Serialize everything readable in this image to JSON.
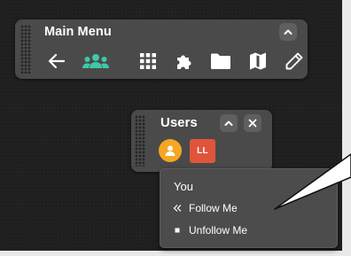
{
  "main_menu": {
    "title": "Main Menu",
    "collapse_icon": "chevron-up-icon",
    "tools": [
      {
        "name": "back",
        "icon": "arrow-left-icon",
        "active": false
      },
      {
        "name": "users",
        "icon": "users-icon",
        "active": true
      },
      {
        "name": "apps",
        "icon": "grid-icon",
        "active": false
      },
      {
        "name": "extensions",
        "icon": "puzzle-icon",
        "active": false
      },
      {
        "name": "files",
        "icon": "folder-icon",
        "active": false
      },
      {
        "name": "map",
        "icon": "map-icon",
        "active": false
      },
      {
        "name": "edit",
        "icon": "pencil-icon",
        "active": false
      }
    ],
    "active_color": "#3ec9a8"
  },
  "users_panel": {
    "title": "Users",
    "avatars": [
      {
        "initials": "",
        "icon": "user-icon",
        "color": "#f5a623"
      },
      {
        "initials": "LL",
        "color": "#e0553a"
      }
    ]
  },
  "context_menu": {
    "header": "You",
    "items": [
      {
        "label": "Follow Me",
        "icon": "double-chevron-left-icon"
      },
      {
        "label": "Unfollow Me",
        "icon": "square-icon"
      }
    ]
  }
}
